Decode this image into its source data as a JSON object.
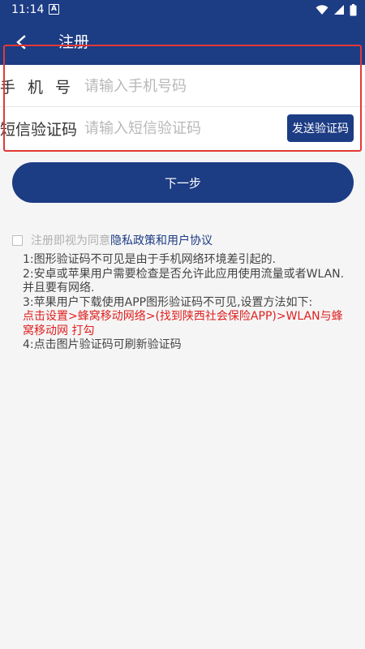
{
  "status_bar": {
    "time": "11:14",
    "notification_badge": "A"
  },
  "app_bar": {
    "title": "注册"
  },
  "form": {
    "phone_label": "手机号",
    "phone_placeholder": "请输入手机号码",
    "sms_label": "短信验证码",
    "sms_placeholder": "请输入短信验证码",
    "send_code_label": "发送验证码"
  },
  "next_button_label": "下一步",
  "agreement": {
    "prefix": "注册即视为同意",
    "link": "隐私政策和用户协议"
  },
  "instructions": {
    "line1": "1:图形验证码不可见是由于手机网络环境差引起的.",
    "line2": "2:安卓或苹果用户需要检查是否允许此应用使用流量或者WLAN.并且要有网络.",
    "line3": "3:苹果用户下载使用APP图形验证码不可见,设置方法如下:",
    "line3_red": "点击设置>蜂窝移动网络>(找到陕西社会保险APP)>WLAN与蜂窝移动网 打勾",
    "line4": "4:点击图片验证码可刷新验证码"
  },
  "colors": {
    "primary": "#1c3c84",
    "highlight": "#e53935",
    "warning_text": "#e02020",
    "background": "#f5f5f5"
  },
  "icons": {
    "back": "back-arrow-icon",
    "wifi": "wifi-icon",
    "signal": "signal-icon",
    "battery": "battery-icon"
  }
}
